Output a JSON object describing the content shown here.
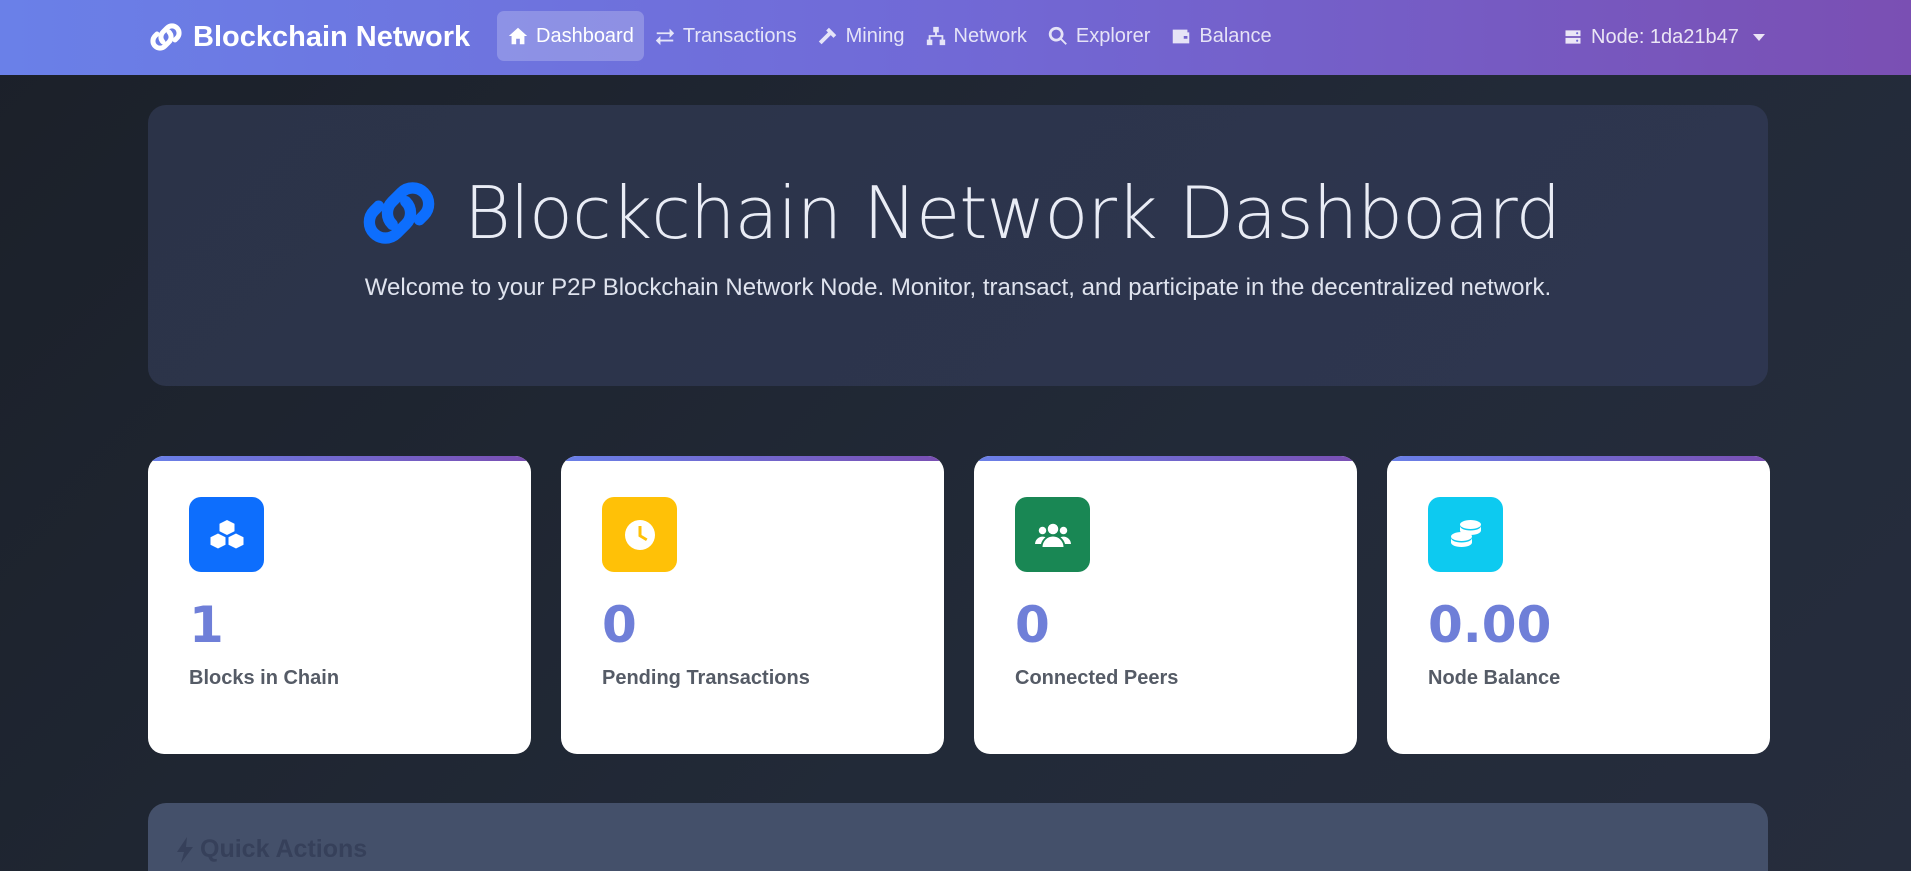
{
  "navbar": {
    "brand": "Blockchain Network",
    "items": [
      {
        "label": "Dashboard",
        "icon": "home-icon",
        "active": true
      },
      {
        "label": "Transactions",
        "icon": "exchange-icon"
      },
      {
        "label": "Mining",
        "icon": "hammer-icon"
      },
      {
        "label": "Network",
        "icon": "network-icon"
      },
      {
        "label": "Explorer",
        "icon": "search-icon"
      },
      {
        "label": "Balance",
        "icon": "wallet-icon"
      }
    ],
    "node": "Node: 1da21b47"
  },
  "hero": {
    "title": "Blockchain Network Dashboard",
    "subtitle": "Welcome to your P2P Blockchain Network Node. Monitor, transact, and participate in the decentralized network."
  },
  "stats": [
    {
      "value": "1",
      "label": "Blocks in Chain",
      "icon": "cubes-icon",
      "color": "#0d6efd"
    },
    {
      "value": "0",
      "label": "Pending Transactions",
      "icon": "clock-icon",
      "color": "#ffc107"
    },
    {
      "value": "0",
      "label": "Connected Peers",
      "icon": "users-icon",
      "color": "#198754"
    },
    {
      "value": "0.00",
      "label": "Node Balance",
      "icon": "coins-icon",
      "color": "#0dcaf0"
    }
  ],
  "quick_actions": {
    "title": "Quick Actions"
  },
  "colors": {
    "accent": "#6f7fd8",
    "link_blue": "#0d6efd"
  }
}
